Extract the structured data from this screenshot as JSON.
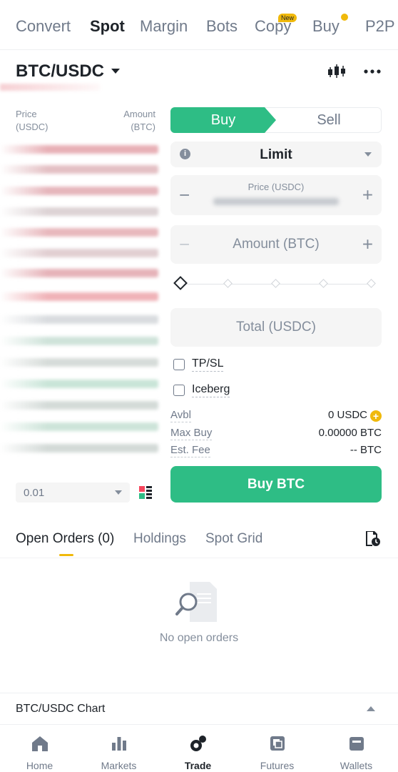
{
  "topnav": {
    "tabs": [
      "Convert",
      "Spot",
      "Margin",
      "Bots",
      "Copy",
      "Buy",
      "P2P"
    ],
    "active": "Spot",
    "copy_badge": "New"
  },
  "pair": {
    "symbol": "BTC/USDC"
  },
  "orderbook": {
    "price_header": "Price\n(USDC)",
    "price_header_l1": "Price",
    "price_header_l2": "(USDC)",
    "amount_header_l1": "Amount",
    "amount_header_l2": "(BTC)",
    "step": "0.01"
  },
  "trade": {
    "buy_tab": "Buy",
    "sell_tab": "Sell",
    "order_type": "Limit",
    "price_label": "Price (USDC)",
    "amount_placeholder": "Amount (BTC)",
    "total_placeholder": "Total (USDC)",
    "tpsl_label": "TP/SL",
    "iceberg_label": "Iceberg",
    "avbl_label": "Avbl",
    "avbl_value": "0 USDC",
    "maxbuy_label": "Max Buy",
    "maxbuy_value": "0.00000 BTC",
    "fee_label": "Est. Fee",
    "fee_value": "-- BTC",
    "buy_button": "Buy BTC"
  },
  "orders": {
    "tabs": [
      "Open Orders (0)",
      "Holdings",
      "Spot Grid"
    ],
    "empty_text": "No open orders"
  },
  "chart_bar": {
    "label": "BTC/USDC Chart"
  },
  "bottomnav": {
    "items": [
      "Home",
      "Markets",
      "Trade",
      "Futures",
      "Wallets"
    ],
    "active": "Trade"
  },
  "colors": {
    "buy_green": "#2ebd85",
    "accent_yellow": "#f0b90b",
    "ask_red": "#f6465d",
    "text_primary": "#1e2329",
    "text_secondary": "#707a8a"
  }
}
